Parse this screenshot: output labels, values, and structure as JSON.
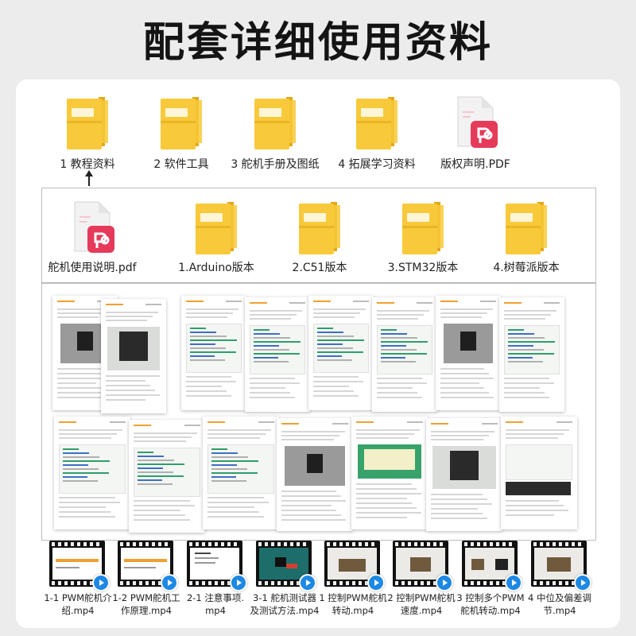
{
  "title": "配套详细使用资料",
  "top_items": [
    {
      "label": "1 教程资料",
      "icon": "folder-icon"
    },
    {
      "label": "2 软件工具",
      "icon": "folder-icon"
    },
    {
      "label": "3 舵机手册及图纸",
      "icon": "folder-icon"
    },
    {
      "label": "4 拓展学习资料",
      "icon": "folder-icon"
    },
    {
      "label": "版权声明.PDF",
      "icon": "pdf-icon"
    }
  ],
  "sub_items": [
    {
      "label": "舵机使用说明.pdf",
      "icon": "pdf-icon"
    },
    {
      "label": "1.Arduino版本",
      "icon": "folder-icon"
    },
    {
      "label": "2.C51版本",
      "icon": "folder-icon"
    },
    {
      "label": "3.STM32版本",
      "icon": "folder-icon"
    },
    {
      "label": "4.树莓派版本",
      "icon": "folder-icon"
    }
  ],
  "videos": [
    {
      "line1": "1-1 PWM舵机介",
      "line2": "绍.mp4"
    },
    {
      "line1": "1-2 PWM舵机工",
      "line2": "作原理.mp4"
    },
    {
      "line1": "2-1 注意事项.",
      "line2": "mp4"
    },
    {
      "line1": "3-1 舵机测试器",
      "line2": "及测试方法.mp4"
    },
    {
      "line1": "1 控制PWM舵机",
      "line2": "转动.mp4"
    },
    {
      "line1": "2 控制PWM舵机",
      "line2": "速度.mp4"
    },
    {
      "line1": "3 控制多个PWM",
      "line2": "舵机转动.mp4"
    },
    {
      "line1": "4 中位及偏差调",
      "line2": "节.mp4"
    }
  ],
  "colors": {
    "folder": "#f8c93a",
    "folder_dark": "#e2a817",
    "pdf_badge": "#e63a5a",
    "play": "#1e88e5"
  }
}
